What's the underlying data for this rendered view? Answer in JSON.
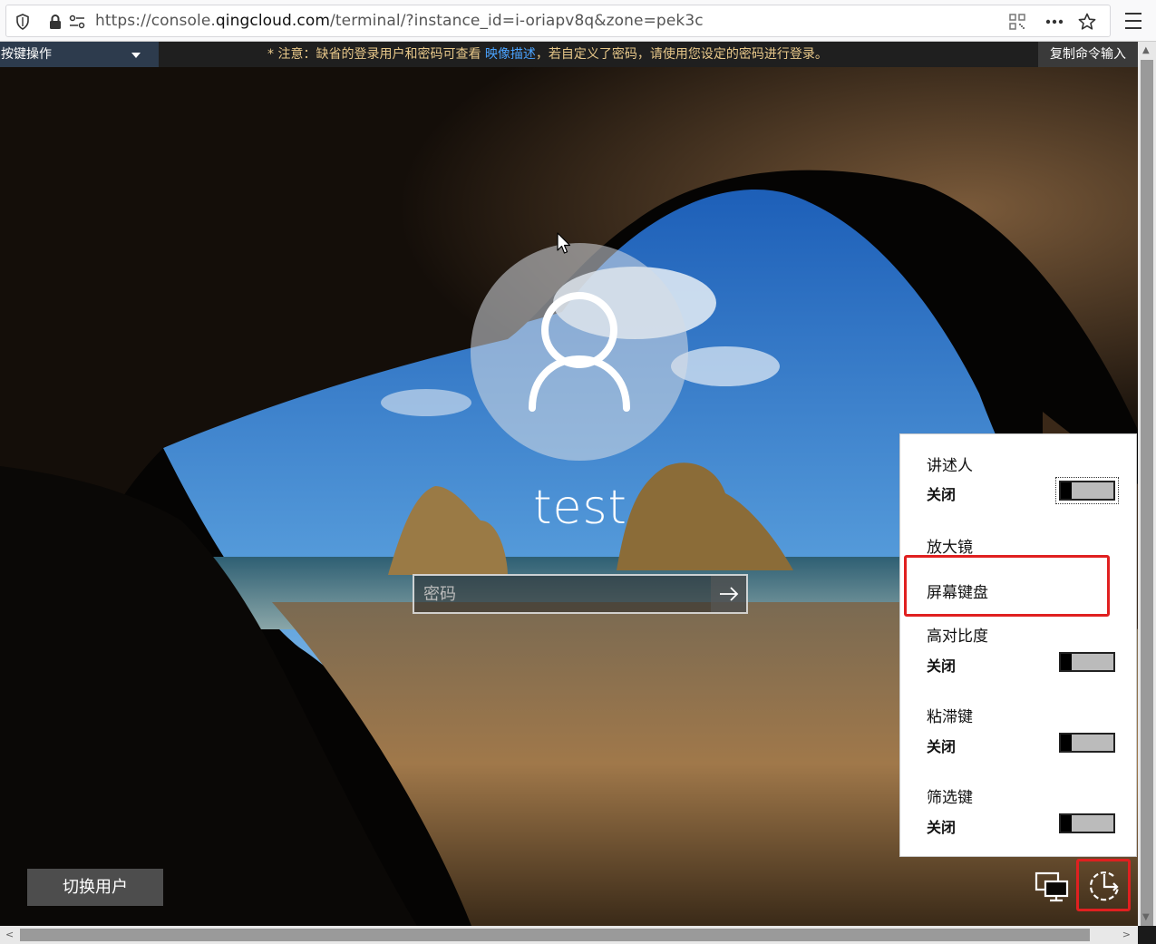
{
  "browser": {
    "url_prefix": "https://console.",
    "url_domain": "qingcloud.com",
    "url_suffix": "/terminal/?instance_id=i-oriapv8q&zone=pek3c"
  },
  "console": {
    "key_select_label": "按键操作",
    "notice_prefix": "* 注意：缺省的登录用户和密码可查看 ",
    "notice_link": "映像描述",
    "notice_suffix": "，若自定义了密码，请使用您设定的密码进行登录。",
    "copy_button": "复制命令输入"
  },
  "login": {
    "username": "test",
    "password_placeholder": "密码",
    "switch_user": "切换用户"
  },
  "accessibility": {
    "narrator_title": "讲述人",
    "narrator_state": "关闭",
    "magnifier_title": "放大镜",
    "onscreen_keyboard_title": "屏幕键盘",
    "high_contrast_title": "高对比度",
    "high_contrast_state": "关闭",
    "sticky_keys_title": "粘滞键",
    "sticky_keys_state": "关闭",
    "filter_keys_title": "筛选键",
    "filter_keys_state": "关闭"
  },
  "colors": {
    "highlight": "#e02020",
    "console_bar": "#1f1f1f",
    "notice_text": "#e8c88a",
    "link": "#4aa3ff"
  },
  "icons": [
    "shield-icon",
    "lock-icon",
    "permissions-icon",
    "qr-code-icon",
    "more-icon",
    "bookmark-star-icon",
    "hamburger-menu-icon",
    "user-avatar-icon",
    "arrow-right-icon",
    "network-icon",
    "ease-of-access-icon"
  ]
}
